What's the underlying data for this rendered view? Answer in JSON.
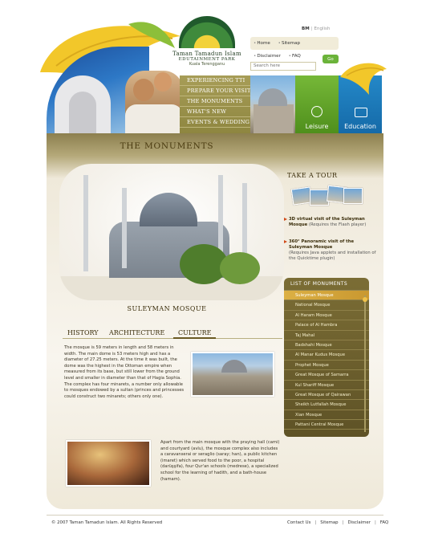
{
  "brand": {
    "title": "Taman Tamadun Islam",
    "subtitle": "EDUTAINMENT PARK",
    "location": "Kuala Terengganu"
  },
  "language": {
    "active": "BM",
    "other": "English"
  },
  "top_links": [
    "Home",
    "Sitemap",
    "Disclaimer",
    "FAQ"
  ],
  "search": {
    "placeholder": "Search here",
    "button": "Go"
  },
  "nav": [
    "EXPERIENCING TTI",
    "PREPARE YOUR VISIT",
    "THE MONUMENTS",
    "WHAT'S NEW",
    "EVENTS & WEDDING"
  ],
  "tiles": {
    "leisure": "Leisure",
    "education": "Education"
  },
  "page_title": "THE MONUMENTS",
  "monument_name": "SULEYMAN MOSQUE",
  "tabs": [
    "HISTORY",
    "ARCHITECTURE",
    "CULTURE"
  ],
  "paragraph1": "The mosque is 59 meters in length and 58 meters in width. The main dome is 53 meters high and has a diameter of 27.25 meters. At the time it was built, the dome was the highest in the Ottoman empire when measured from its base, but still lower from the ground level and smaller in diameter than that of Hagia Sophia. The complex has four minarets, a number only allowable to mosques endowed by a sultan (princes and princesses could construct two minarets; others only one).",
  "paragraph2": "Apart from the main mosque with the praying hall (cami) and courtyard (avlu), the mosque complex also includes a caravanserai or seraglio (saray; han), a public kitchen (imaret) which served food to the poor, a hospital (darüşşifa), four Qur'an schools (medrese), a specialized school for the learning of hadith, and a bath-house (hamam).",
  "tour": {
    "title": "TAKE A TOUR",
    "link1_title": "3D virtual visit of the Suleyman Mosque",
    "link1_note": "(Requires the Flash player)",
    "link2_title": "360° Panoramic visit of the Suleyman Mosque",
    "link2_note": "(Requires Java applets and installation of the Quicktime plugin)"
  },
  "monuments_list": {
    "title": "LIST OF MONUMENTS",
    "items": [
      "Suleyman Mosque",
      "National Mosque",
      "Al Haram Mosque",
      "Palace of Al Hambra",
      "Taj Mahal",
      "Badshahi Mosque",
      "Al Manar Kudus Mosque",
      "Prophet Mosque",
      "Great Mosque of Samarra",
      "Kul Shariff Mosque",
      "Great Mosque of Qairawan",
      "Sheikh Lutfallah Mosque",
      "Xian Mosque",
      "Pattani Central Mosque"
    ],
    "active_index": 0
  },
  "footer": {
    "copyright": "© 2007 Taman Tamadun Islam. All Rights Reserved",
    "links": [
      "Contact Us",
      "Sitemap",
      "Disclaimer",
      "FAQ"
    ]
  },
  "colors": {
    "olive": "#8e8640",
    "leisure_green": "#6bb33a",
    "education_blue": "#1b78b8",
    "accent_orange": "#d04a19"
  }
}
